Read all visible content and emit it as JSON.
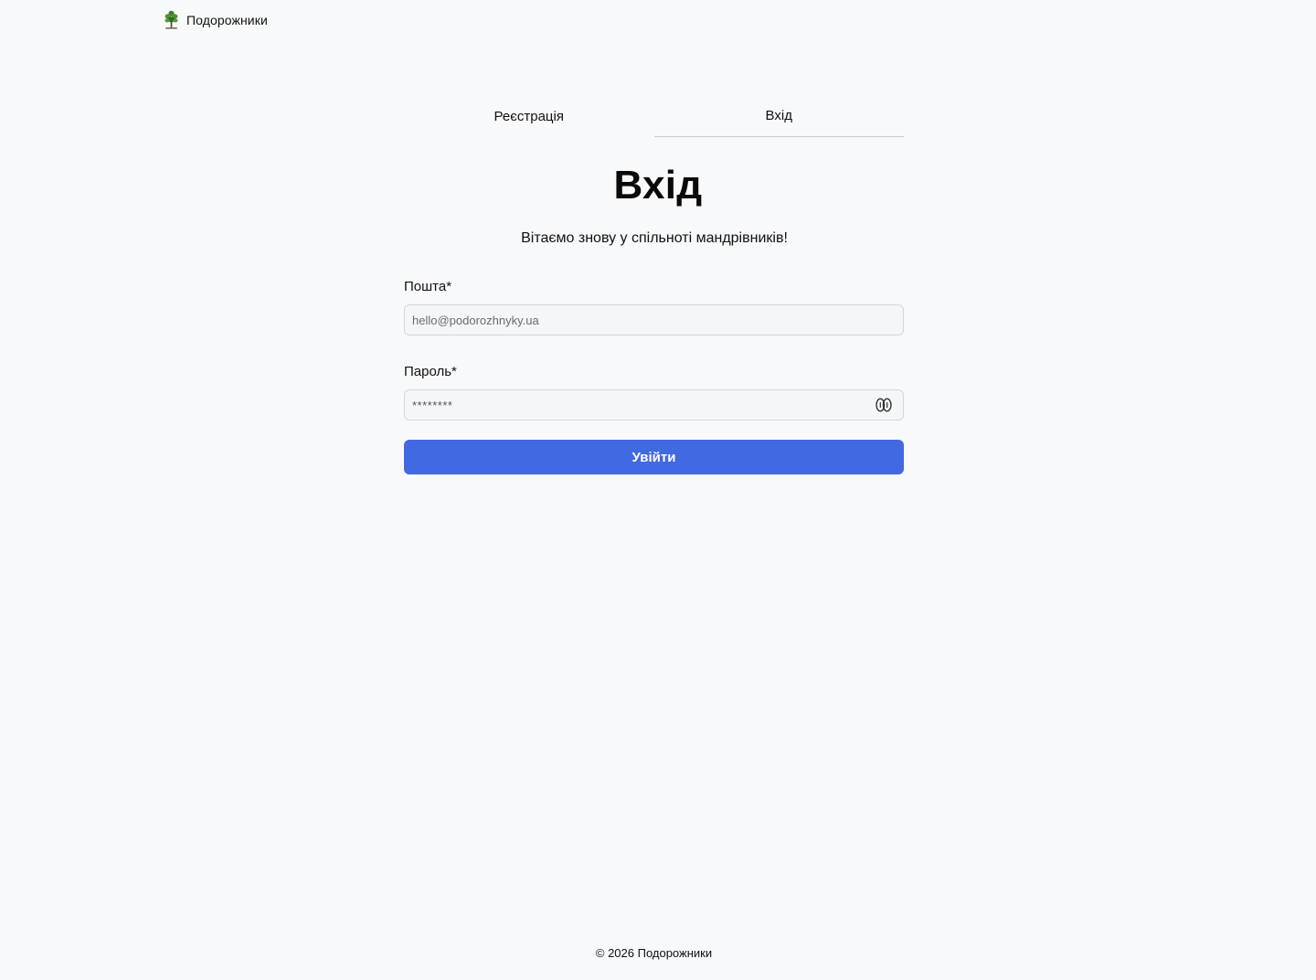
{
  "header": {
    "logo_icon": "tree-icon",
    "brand_name": "Подорожники"
  },
  "tabs": [
    {
      "label": "Реєстрація",
      "active": false
    },
    {
      "label": "Вхід",
      "active": true
    }
  ],
  "main": {
    "title": "Вхід",
    "subtitle": "Вітаємо знову у спільноті мандрівників!"
  },
  "form": {
    "email": {
      "label": "Пошта*",
      "placeholder": "hello@podorozhnyky.ua",
      "value": ""
    },
    "password": {
      "label": "Пароль*",
      "placeholder": "********",
      "value": "",
      "toggle_icon": "eye-icon"
    },
    "submit_label": "Увійти"
  },
  "footer": {
    "copyright": "© 2026 Подорожники"
  },
  "colors": {
    "accent": "#4169e1",
    "background": "#f8f9fb",
    "input_border": "#d4d6da"
  }
}
